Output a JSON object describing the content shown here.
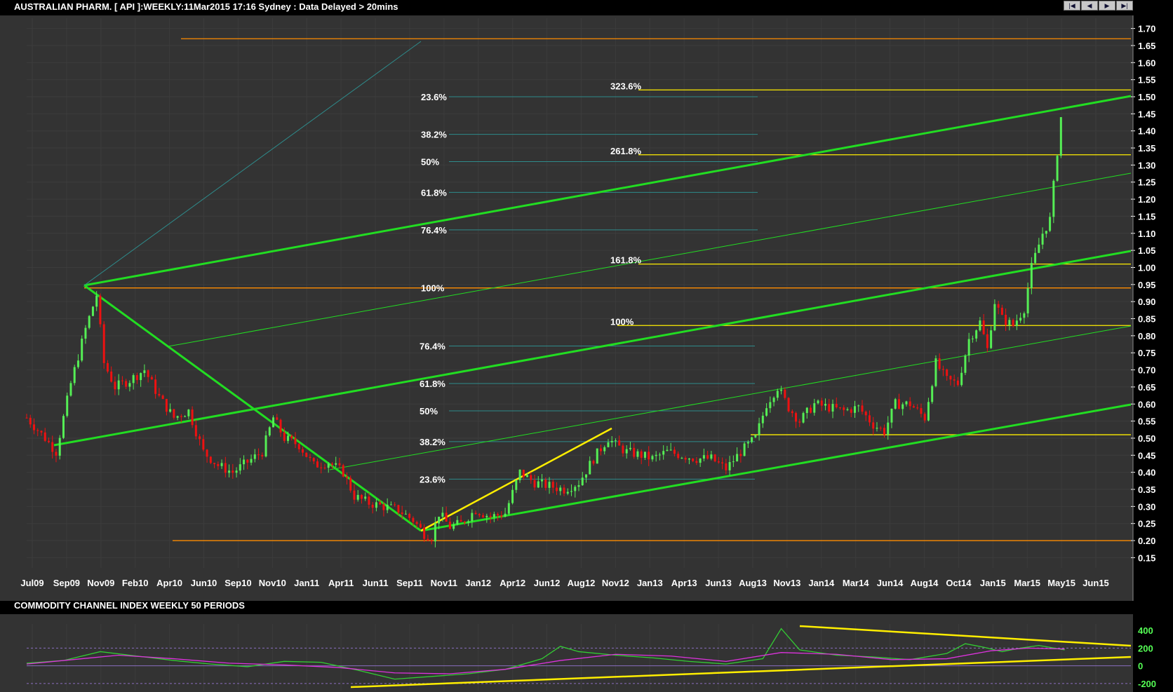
{
  "header": {
    "title": "AUSTRALIAN PHARM. [ API ]:WEEKLY:11Mar2015 17:16 Sydney : Data Delayed > 20mins",
    "nav": [
      {
        "icon": "first-icon",
        "glyph": "|◀"
      },
      {
        "icon": "prev-icon",
        "glyph": "◀"
      },
      {
        "icon": "next-icon",
        "glyph": "▶"
      },
      {
        "icon": "last-icon",
        "glyph": "▶|"
      }
    ]
  },
  "colors": {
    "background": "#000000",
    "panel": "#333333",
    "grid": "#3c3c3c",
    "up": "#55ee55",
    "down": "#ee1111",
    "channel": "#22dd22",
    "fib_h": "#2e8b8b",
    "orange": "#ff8c00",
    "yellow": "#ffee00",
    "axis_text": "#ffffff",
    "cci": "#33cc33",
    "cci_ma": "#dd33dd"
  },
  "chart_data": [
    {
      "type": "candlestick",
      "title": "AUSTRALIAN PHARM. [ API ]:WEEKLY:11Mar2015 17:16 Sydney : Data Delayed > 20mins",
      "x_ticks": [
        "Jul09",
        "Sep09",
        "Nov09",
        "Feb10",
        "Apr10",
        "Jun10",
        "Sep10",
        "Nov10",
        "Jan11",
        "Apr11",
        "Jun11",
        "Sep11",
        "Nov11",
        "Jan12",
        "Apr12",
        "Jun12",
        "Aug12",
        "Nov12",
        "Jan13",
        "Apr13",
        "Jun13",
        "Aug13",
        "Nov13",
        "Jan14",
        "Mar14",
        "Jun14",
        "Aug14",
        "Oct14",
        "Jan15",
        "Mar15",
        "May15",
        "Jun15"
      ],
      "y_ticks": [
        "1.70",
        "1.65",
        "1.60",
        "1.55",
        "1.50",
        "1.45",
        "1.40",
        "1.35",
        "1.30",
        "1.25",
        "1.20",
        "1.15",
        "1.10",
        "1.05",
        "1.00",
        "0.95",
        "0.90",
        "0.85",
        "0.80",
        "0.75",
        "0.70",
        "0.65",
        "0.60",
        "0.55",
        "0.50",
        "0.45",
        "0.40",
        "0.35",
        "0.30",
        "0.25",
        "0.20",
        "0.15"
      ],
      "ylim": [
        0.12,
        1.73
      ],
      "price_path_weekly_close": [
        [
          0,
          0.56
        ],
        [
          5,
          0.5
        ],
        [
          8,
          0.46
        ],
        [
          12,
          0.66
        ],
        [
          16,
          0.82
        ],
        [
          19,
          0.92
        ],
        [
          21,
          0.72
        ],
        [
          24,
          0.65
        ],
        [
          28,
          0.67
        ],
        [
          32,
          0.7
        ],
        [
          36,
          0.62
        ],
        [
          40,
          0.56
        ],
        [
          44,
          0.58
        ],
        [
          48,
          0.46
        ],
        [
          52,
          0.42
        ],
        [
          56,
          0.4
        ],
        [
          60,
          0.43
        ],
        [
          64,
          0.46
        ],
        [
          67,
          0.56
        ],
        [
          70,
          0.5
        ],
        [
          74,
          0.48
        ],
        [
          78,
          0.42
        ],
        [
          82,
          0.43
        ],
        [
          86,
          0.4
        ],
        [
          89,
          0.33
        ],
        [
          93,
          0.31
        ],
        [
          97,
          0.3
        ],
        [
          101,
          0.29
        ],
        [
          105,
          0.26
        ],
        [
          108,
          0.22
        ],
        [
          110,
          0.21
        ],
        [
          112,
          0.28
        ],
        [
          115,
          0.24
        ],
        [
          118,
          0.25
        ],
        [
          122,
          0.29
        ],
        [
          126,
          0.27
        ],
        [
          130,
          0.28
        ],
        [
          134,
          0.4
        ],
        [
          138,
          0.37
        ],
        [
          142,
          0.36
        ],
        [
          146,
          0.35
        ],
        [
          150,
          0.37
        ],
        [
          154,
          0.44
        ],
        [
          158,
          0.5
        ],
        [
          160,
          0.48
        ],
        [
          163,
          0.46
        ],
        [
          167,
          0.45
        ],
        [
          170,
          0.44
        ],
        [
          174,
          0.46
        ],
        [
          178,
          0.45
        ],
        [
          182,
          0.44
        ],
        [
          186,
          0.44
        ],
        [
          190,
          0.41
        ],
        [
          194,
          0.46
        ],
        [
          198,
          0.5
        ],
        [
          201,
          0.6
        ],
        [
          204,
          0.65
        ],
        [
          207,
          0.59
        ],
        [
          210,
          0.55
        ],
        [
          214,
          0.6
        ],
        [
          218,
          0.59
        ],
        [
          222,
          0.58
        ],
        [
          226,
          0.59
        ],
        [
          230,
          0.54
        ],
        [
          233,
          0.52
        ],
        [
          236,
          0.6
        ],
        [
          240,
          0.6
        ],
        [
          244,
          0.56
        ],
        [
          247,
          0.72
        ],
        [
          250,
          0.67
        ],
        [
          253,
          0.66
        ],
        [
          256,
          0.79
        ],
        [
          259,
          0.84
        ],
        [
          261,
          0.76
        ],
        [
          263,
          0.9
        ],
        [
          265,
          0.85
        ],
        [
          268,
          0.83
        ],
        [
          271,
          0.88
        ],
        [
          273,
          1.0
        ],
        [
          276,
          1.1
        ],
        [
          278,
          1.14
        ],
        [
          281,
          1.44
        ]
      ],
      "horizontal_levels": [
        {
          "value": 1.67,
          "color": "orange"
        },
        {
          "value": 0.94,
          "color": "orange"
        },
        {
          "value": 0.2,
          "color": "orange"
        },
        {
          "value": 1.52,
          "color": "yellow"
        },
        {
          "value": 1.33,
          "color": "yellow"
        },
        {
          "value": 1.01,
          "color": "yellow"
        },
        {
          "value": 0.83,
          "color": "yellow"
        },
        {
          "value": 0.51,
          "color": "yellow"
        }
      ],
      "fib_retracement_upper": [
        {
          "label": "23.6%",
          "value": 1.5
        },
        {
          "label": "38.2%",
          "value": 1.39
        },
        {
          "label": "50%",
          "value": 1.31
        },
        {
          "label": "61.8%",
          "value": 1.22
        },
        {
          "label": "76.4%",
          "value": 1.11
        },
        {
          "label": "100%",
          "value": 0.94
        }
      ],
      "fib_retracement_lower": [
        {
          "label": "76.4%",
          "value": 0.77
        },
        {
          "label": "61.8%",
          "value": 0.66
        },
        {
          "label": "50%",
          "value": 0.58
        },
        {
          "label": "38.2%",
          "value": 0.49
        },
        {
          "label": "23.6%",
          "value": 0.38
        }
      ],
      "fib_extension": [
        {
          "label": "323.6%",
          "value": 1.52
        },
        {
          "label": "261.8%",
          "value": 1.33
        },
        {
          "label": "161.8%",
          "value": 1.01
        },
        {
          "label": "100%",
          "value": 0.83
        }
      ]
    },
    {
      "type": "line",
      "title": "COMMODITY CHANNEL INDEX WEEKLY 50 PERIODS",
      "y_ticks": [
        "400",
        "200",
        "0",
        "-200"
      ],
      "ylim": [
        -280,
        520
      ],
      "reference_levels": [
        200,
        0,
        -200
      ],
      "series": [
        {
          "values": [
            [
              0,
              30
            ],
            [
              10,
              60
            ],
            [
              20,
              160
            ],
            [
              30,
              110
            ],
            [
              40,
              60
            ],
            [
              50,
              20
            ],
            [
              60,
              -10
            ],
            [
              70,
              50
            ],
            [
              80,
              40
            ],
            [
              90,
              -50
            ],
            [
              100,
              -150
            ],
            [
              110,
              -120
            ],
            [
              120,
              -90
            ],
            [
              130,
              -40
            ],
            [
              140,
              80
            ],
            [
              145,
              220
            ],
            [
              150,
              160
            ],
            [
              160,
              120
            ],
            [
              170,
              90
            ],
            [
              180,
              50
            ],
            [
              190,
              20
            ],
            [
              200,
              80
            ],
            [
              205,
              420
            ],
            [
              210,
              180
            ],
            [
              220,
              120
            ],
            [
              230,
              100
            ],
            [
              240,
              70
            ],
            [
              250,
              140
            ],
            [
              255,
              250
            ],
            [
              260,
              210
            ],
            [
              265,
              160
            ],
            [
              270,
              200
            ],
            [
              275,
              230
            ],
            [
              282,
              180
            ]
          ]
        },
        {
          "values": [
            [
              0,
              20
            ],
            [
              15,
              80
            ],
            [
              25,
              120
            ],
            [
              40,
              80
            ],
            [
              55,
              30
            ],
            [
              70,
              10
            ],
            [
              85,
              -20
            ],
            [
              100,
              -80
            ],
            [
              115,
              -90
            ],
            [
              130,
              -40
            ],
            [
              145,
              60
            ],
            [
              160,
              130
            ],
            [
              175,
              110
            ],
            [
              190,
              50
            ],
            [
              205,
              150
            ],
            [
              220,
              130
            ],
            [
              235,
              70
            ],
            [
              250,
              80
            ],
            [
              262,
              170
            ],
            [
              272,
              200
            ],
            [
              282,
              190
            ]
          ]
        }
      ]
    }
  ],
  "sub_title": "COMMODITY CHANNEL INDEX WEEKLY 50 PERIODS"
}
